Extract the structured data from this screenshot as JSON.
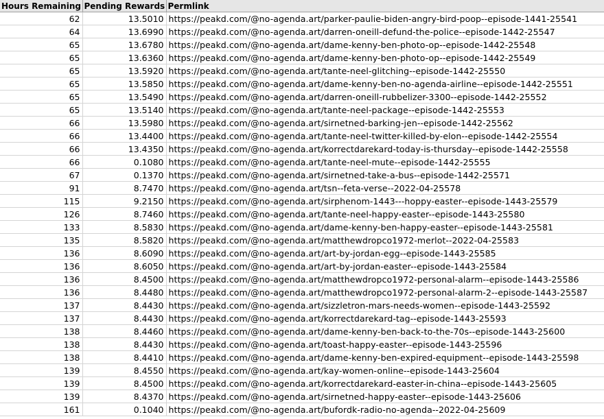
{
  "columns": [
    {
      "label": "Hours Remaining",
      "icon": "menu-icon"
    },
    {
      "label": "Pending Rewards",
      "icon": "menu-icon"
    },
    {
      "label": "Permlink"
    }
  ],
  "rows": [
    {
      "hours": "62",
      "rewards": "13.5010",
      "permlink": "https://peakd.com/@no-agenda.art/parker-paulie-biden-angry-bird-poop--episode-1441-25541"
    },
    {
      "hours": "64",
      "rewards": "13.6990",
      "permlink": "https://peakd.com/@no-agenda.art/darren-oneill-defund-the-police--episode-1442-25547"
    },
    {
      "hours": "65",
      "rewards": "13.6780",
      "permlink": "https://peakd.com/@no-agenda.art/dame-kenny-ben-photo-op--episode-1442-25548"
    },
    {
      "hours": "65",
      "rewards": "13.6360",
      "permlink": "https://peakd.com/@no-agenda.art/dame-kenny-ben-photo-op--episode-1442-25549"
    },
    {
      "hours": "65",
      "rewards": "13.5920",
      "permlink": "https://peakd.com/@no-agenda.art/tante-neel-glitching--episode-1442-25550"
    },
    {
      "hours": "65",
      "rewards": "13.5850",
      "permlink": "https://peakd.com/@no-agenda.art/dame-kenny-ben-no-agenda-airline--episode-1442-25551"
    },
    {
      "hours": "65",
      "rewards": "13.5490",
      "permlink": "https://peakd.com/@no-agenda.art/darren-oneill-rubbelizer-3300--episode-1442-25552"
    },
    {
      "hours": "65",
      "rewards": "13.5140",
      "permlink": "https://peakd.com/@no-agenda.art/tante-neel-package--episode-1442-25553"
    },
    {
      "hours": "66",
      "rewards": "13.5980",
      "permlink": "https://peakd.com/@no-agenda.art/sirnetned-barking-jen--episode-1442-25562"
    },
    {
      "hours": "66",
      "rewards": "13.4400",
      "permlink": "https://peakd.com/@no-agenda.art/tante-neel-twitter-killed-by-elon--episode-1442-25554"
    },
    {
      "hours": "66",
      "rewards": "13.4350",
      "permlink": "https://peakd.com/@no-agenda.art/korrectdarekard-today-is-thursday--episode-1442-25558"
    },
    {
      "hours": "66",
      "rewards": "0.1080",
      "permlink": "https://peakd.com/@no-agenda.art/tante-neel-mute--episode-1442-25555"
    },
    {
      "hours": "67",
      "rewards": "0.1370",
      "permlink": "https://peakd.com/@no-agenda.art/sirnetned-take-a-bus--episode-1442-25571"
    },
    {
      "hours": "91",
      "rewards": "8.7470",
      "permlink": "https://peakd.com/@no-agenda.art/tsn--feta-verse--2022-04-25578"
    },
    {
      "hours": "115",
      "rewards": "9.2150",
      "permlink": "https://peakd.com/@no-agenda.art/sirphenom-1443---hoppy-easter--episode-1443-25579"
    },
    {
      "hours": "126",
      "rewards": "8.7460",
      "permlink": "https://peakd.com/@no-agenda.art/tante-neel-happy-easter--episode-1443-25580"
    },
    {
      "hours": "133",
      "rewards": "8.5830",
      "permlink": "https://peakd.com/@no-agenda.art/dame-kenny-ben-happy-easter--episode-1443-25581"
    },
    {
      "hours": "135",
      "rewards": "8.5820",
      "permlink": "https://peakd.com/@no-agenda.art/matthewdropco1972-merlot--2022-04-25583"
    },
    {
      "hours": "136",
      "rewards": "8.6090",
      "permlink": "https://peakd.com/@no-agenda.art/art-by-jordan-egg--episode-1443-25585"
    },
    {
      "hours": "136",
      "rewards": "8.6050",
      "permlink": "https://peakd.com/@no-agenda.art/art-by-jordan-easter--episode-1443-25584"
    },
    {
      "hours": "136",
      "rewards": "8.4500",
      "permlink": "https://peakd.com/@no-agenda.art/matthewdropco1972-personal-alarm--episode-1443-25586"
    },
    {
      "hours": "136",
      "rewards": "8.4480",
      "permlink": "https://peakd.com/@no-agenda.art/matthewdropco1972-personal-alarm-2--episode-1443-25587"
    },
    {
      "hours": "137",
      "rewards": "8.4430",
      "permlink": "https://peakd.com/@no-agenda.art/sizzletron-mars-needs-women--episode-1443-25592"
    },
    {
      "hours": "137",
      "rewards": "8.4430",
      "permlink": "https://peakd.com/@no-agenda.art/korrectdarekard-tag--episode-1443-25593"
    },
    {
      "hours": "138",
      "rewards": "8.4460",
      "permlink": "https://peakd.com/@no-agenda.art/dame-kenny-ben-back-to-the-70s--episode-1443-25600"
    },
    {
      "hours": "138",
      "rewards": "8.4430",
      "permlink": "https://peakd.com/@no-agenda.art/toast-happy-easter--episode-1443-25596"
    },
    {
      "hours": "138",
      "rewards": "8.4410",
      "permlink": "https://peakd.com/@no-agenda.art/dame-kenny-ben-expired-equipment--episode-1443-25598"
    },
    {
      "hours": "139",
      "rewards": "8.4550",
      "permlink": "https://peakd.com/@no-agenda.art/kay-women-online--episode-1443-25604"
    },
    {
      "hours": "139",
      "rewards": "8.4500",
      "permlink": "https://peakd.com/@no-agenda.art/korrectdarekard-easter-in-china--episode-1443-25605"
    },
    {
      "hours": "139",
      "rewards": "8.4370",
      "permlink": "https://peakd.com/@no-agenda.art/sirnetned-happy-easter--episode-1443-25606"
    },
    {
      "hours": "161",
      "rewards": "0.1040",
      "permlink": "https://peakd.com/@no-agenda.art/bufordk-radio-no-agenda--2022-04-25609"
    }
  ]
}
